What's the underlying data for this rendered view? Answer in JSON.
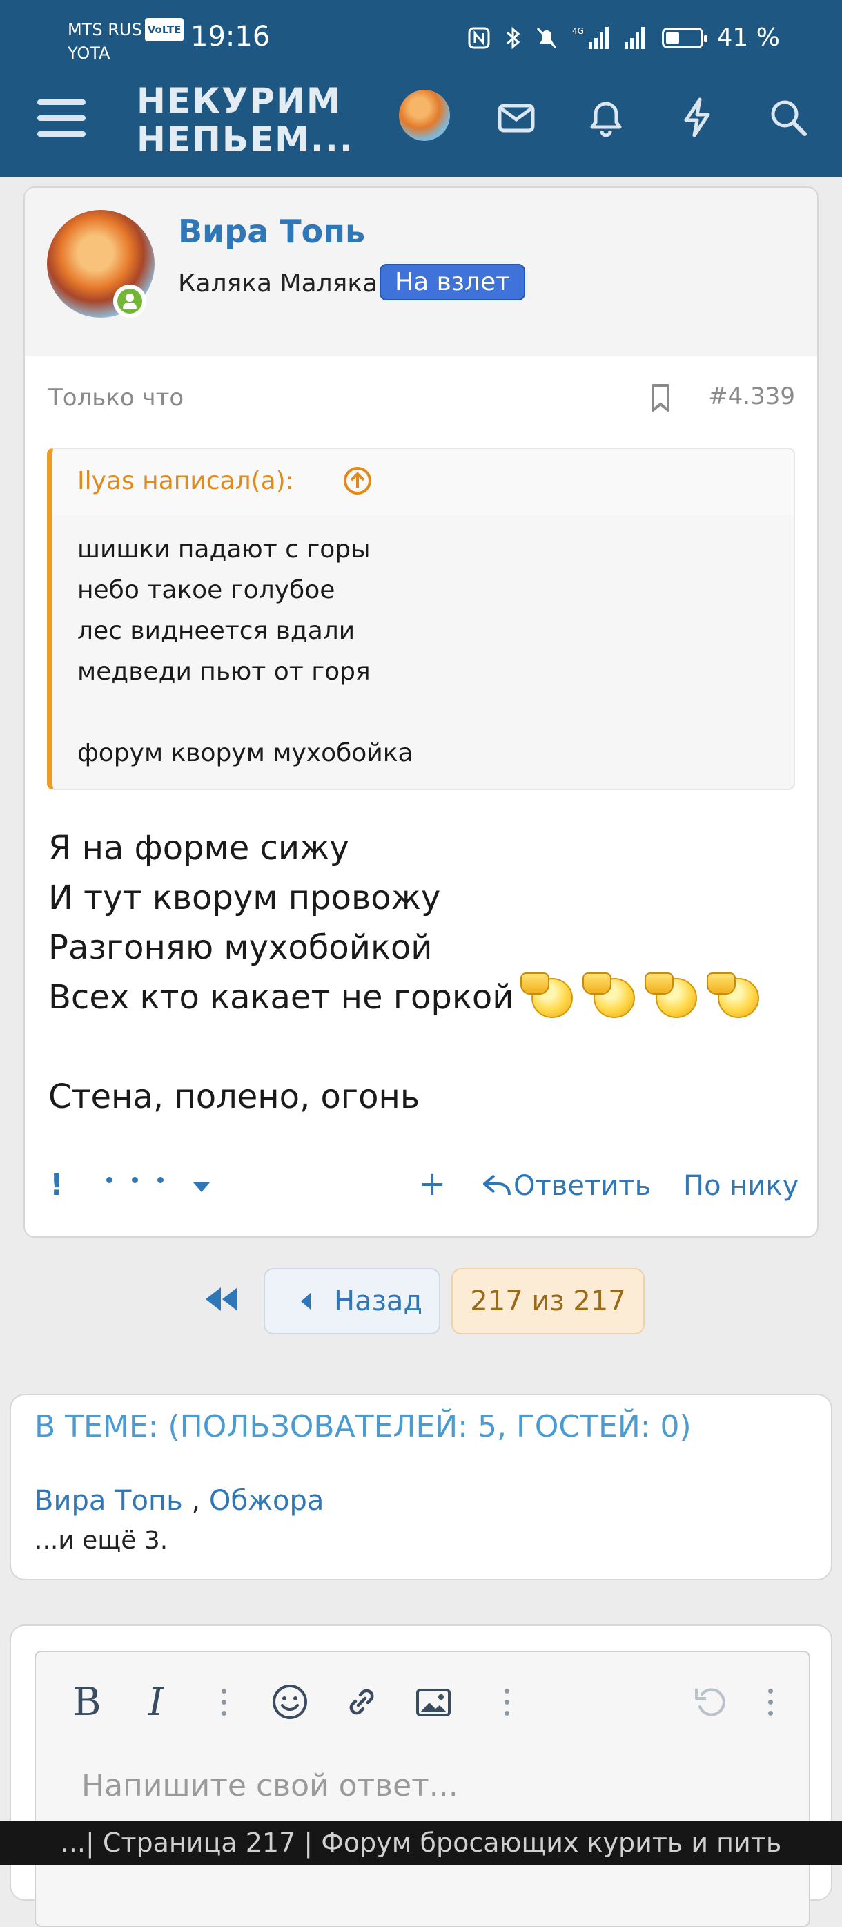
{
  "status_bar": {
    "carrier_1": "MTS RUS",
    "volte": "VoLTE",
    "carrier_2": "YOTA",
    "time": "19:16",
    "network": "4G",
    "battery_text": "41 %",
    "battery_level": 0.41
  },
  "header": {
    "logo_line1": "НЕКУРИМ",
    "logo_line2": "НЕПЬЕМ...",
    "icons": [
      "menu-icon",
      "avatar",
      "mail-icon",
      "bell-icon",
      "lightning-icon",
      "search-icon"
    ]
  },
  "post": {
    "author": "Вира Топь",
    "user_title": "Каляка Маляка",
    "badge": "На взлет",
    "time": "Только что",
    "number": "#4.339",
    "quote": {
      "author": "Ilyas написал(а):",
      "lines": [
        "шишки падают с горы",
        "небо такое голубое",
        "лес виднеется вдали",
        "медведи пьют от горя",
        "",
        "форум кворум мухобойка"
      ]
    },
    "message_lines": [
      "Я на форме сижу",
      "И тут кворум провожу",
      "Разгоняю мухобойкой",
      "Всех кто какает не горкой",
      "",
      "Стена, полено, огонь"
    ],
    "emoji_count": 4,
    "actions": {
      "exclaim": "!",
      "plus": "+",
      "reply": "Ответить",
      "by_nick": "По нику"
    }
  },
  "pagination": {
    "back": "Назад",
    "current": "217 из 217"
  },
  "in_topic": {
    "title": "В ТЕМЕ: (ПОЛЬЗОВАТЕЛЕЙ: 5, ГОСТЕЙ: 0)",
    "user_1": "Вира Топь",
    "separator": ",",
    "user_2": "Обжора",
    "more": "...и ещё 3."
  },
  "editor": {
    "bold": "B",
    "italic": "I",
    "placeholder": "Напишите свой ответ..."
  },
  "url_bar": "...| Страница 217 | Форум бросающих курить и пить"
}
